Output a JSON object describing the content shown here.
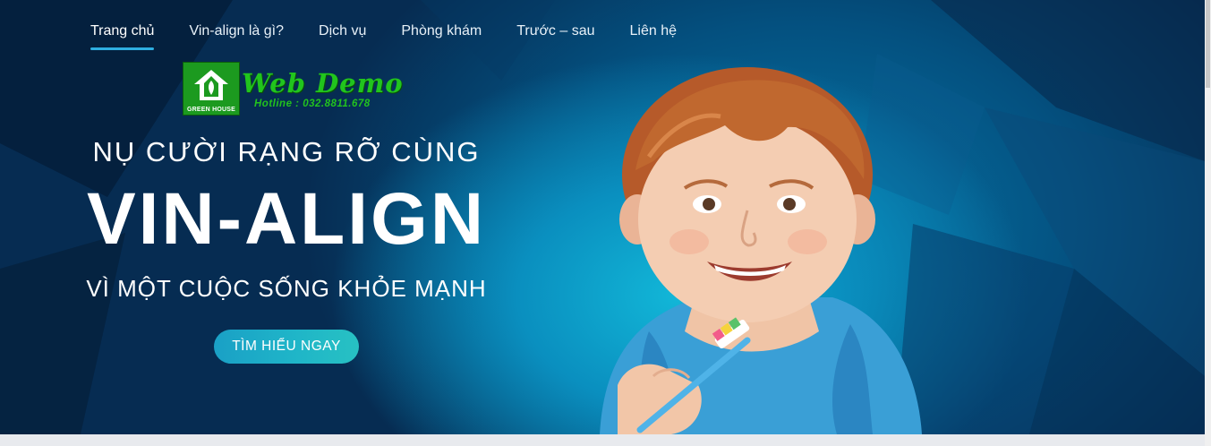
{
  "nav": {
    "items": [
      {
        "label": "Trang chủ",
        "active": true
      },
      {
        "label": "Vin-align là gì?",
        "active": false
      },
      {
        "label": "Dịch vụ",
        "active": false
      },
      {
        "label": "Phòng khám",
        "active": false
      },
      {
        "label": "Trước – sau",
        "active": false
      },
      {
        "label": "Liên hệ",
        "active": false
      }
    ],
    "active_underline_color": "#2eaee0"
  },
  "watermark": {
    "logo_caption": "GREEN HOUSE",
    "title": "Web Demo",
    "hotline": "Hotline : 032.8811.678",
    "color": "#1c9a1f"
  },
  "hero": {
    "line1": "NỤ CƯỜI RẠNG RỠ CÙNG",
    "line2": "VIN-ALIGN",
    "line3": "VÌ MỘT CUỘC SỐNG KHỎE MẠNH",
    "cta_label": "TÌM HIỂU NGAY",
    "image_subject": "smiling child holding a toothbrush with a blue towel",
    "background_colors": [
      "#041b33",
      "#0a8fbf",
      "#12b7d8"
    ]
  }
}
